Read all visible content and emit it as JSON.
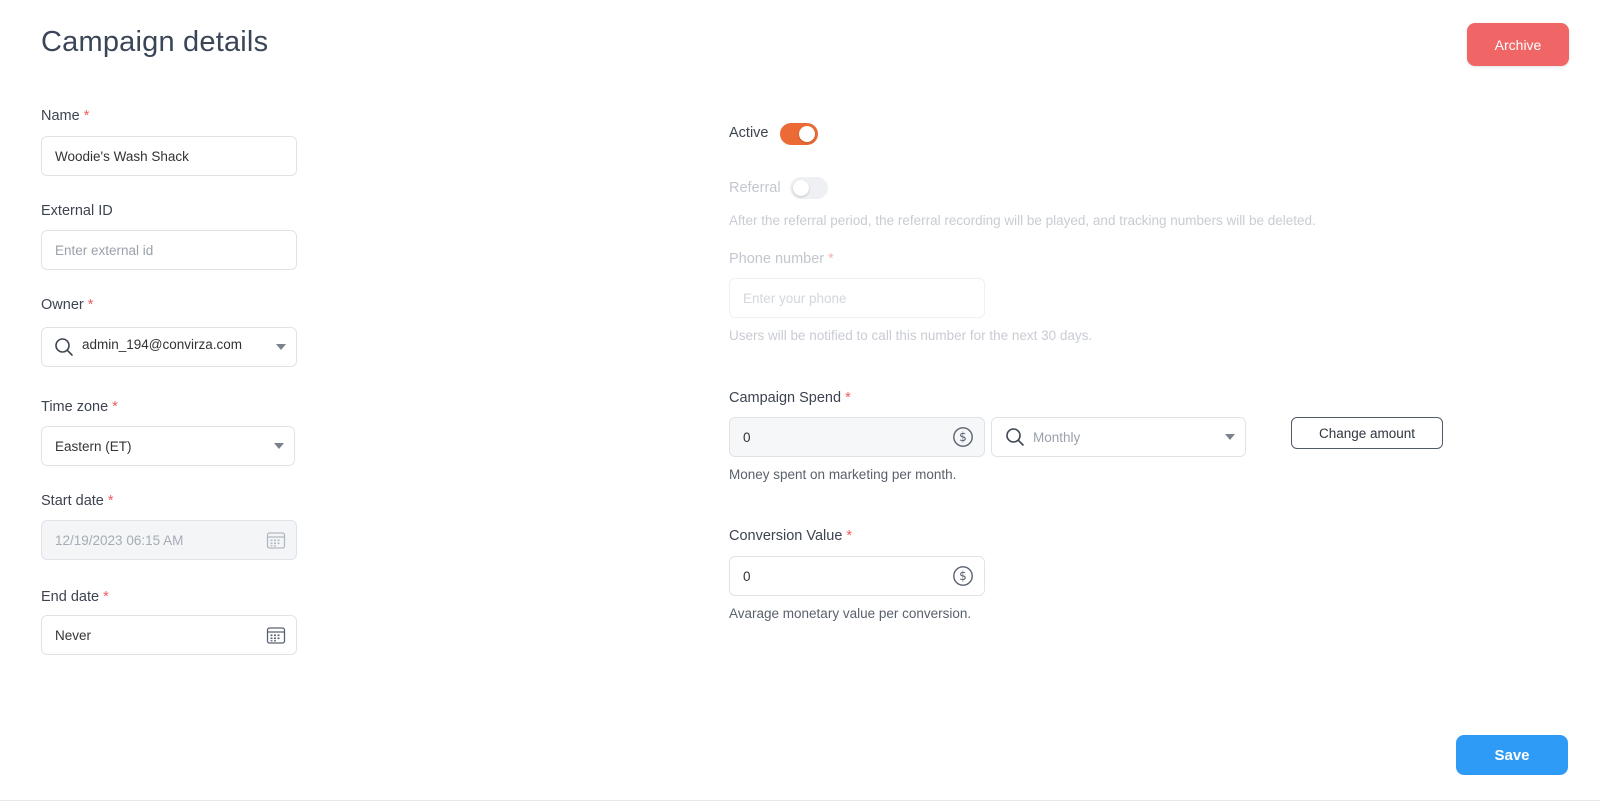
{
  "page": {
    "title": "Campaign details"
  },
  "header": {
    "archive_label": "Archive"
  },
  "left": {
    "name": {
      "label": "Name",
      "required": "*",
      "value": "Woodie's Wash Shack"
    },
    "external_id": {
      "label": "External ID",
      "placeholder": "Enter external id"
    },
    "owner": {
      "label": "Owner",
      "required": "*",
      "value": "admin_194@convirza.com",
      "icon": "search-icon"
    },
    "time_zone": {
      "label": "Time zone",
      "required": "*",
      "value": "Eastern (ET)"
    },
    "start_date": {
      "label": "Start date",
      "required": "*",
      "value": "12/19/2023 06:15 AM",
      "icon": "calendar-icon"
    },
    "end_date": {
      "label": "End date",
      "required": "*",
      "value": "Never",
      "icon": "calendar-icon"
    }
  },
  "right": {
    "active": {
      "label": "Active",
      "on": true,
      "color": "#ec6a35"
    },
    "referral": {
      "label": "Referral",
      "on": false,
      "help": "After the referral period, the referral recording will be played, and tracking numbers will be deleted."
    },
    "phone": {
      "label": "Phone number",
      "required": "*",
      "placeholder": "Enter your phone",
      "help": "Users will be notified to call this number for the next 30 days."
    },
    "campaign_spend": {
      "label": "Campaign Spend",
      "required": "*",
      "value": "0",
      "period": "Monthly",
      "change_label": "Change amount",
      "help": "Money spent on marketing per month.",
      "icon": "dollar-icon"
    },
    "conversion_value": {
      "label": "Conversion Value",
      "required": "*",
      "value": "0",
      "help": "Avarage monetary value per conversion.",
      "icon": "dollar-icon"
    }
  },
  "footer": {
    "save_label": "Save"
  },
  "colors": {
    "archive": "#f06666",
    "save": "#2e9bf7",
    "required": "#ef5b5b"
  }
}
